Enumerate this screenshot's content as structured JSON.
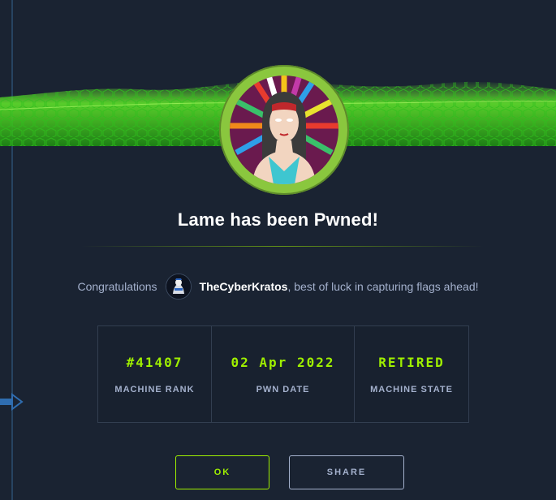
{
  "modal": {
    "title": "Lame has been Pwned!",
    "congrats_prefix": "Congratulations",
    "username": "TheCyberKratos",
    "congrats_suffix": ", best of luck in capturing flags ahead!"
  },
  "stats": [
    {
      "value": "#41407",
      "label": "MACHINE RANK"
    },
    {
      "value": "02 Apr 2022",
      "label": "PWN DATE"
    },
    {
      "value": "RETIRED",
      "label": "MACHINE STATE"
    }
  ],
  "buttons": {
    "ok": "OK",
    "share": "SHARE"
  },
  "icons": {
    "left_arrow": "arrow-right-icon",
    "banner": "green-digital-wave",
    "machine_avatar": "lame-machine-avatar",
    "user_avatar": "user-avatar"
  },
  "colors": {
    "background": "#1a2332",
    "accent": "#9fef00",
    "text_muted": "#a4b1cd",
    "avatar_ring": "#8ac73e"
  }
}
